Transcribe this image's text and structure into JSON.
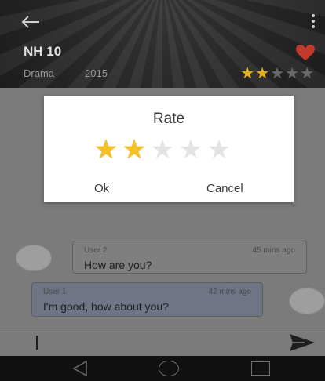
{
  "header": {
    "title": "NH 10",
    "genre": "Drama",
    "year": "2015",
    "rating_filled": 2,
    "rating_total": 5
  },
  "chat": {
    "messages": [
      {
        "user": "User 2",
        "time": "45 mins ago",
        "text": "How are you?"
      },
      {
        "user": "User 1",
        "time": "42 mins ago",
        "text": "I'm good, how about you?"
      }
    ]
  },
  "input": {
    "value": ""
  },
  "dialog": {
    "title": "Rate",
    "rating_selected": 2,
    "rating_total": 5,
    "ok_label": "Ok",
    "cancel_label": "Cancel"
  },
  "colors": {
    "star_on": "#f5c023",
    "star_off": "#e3e3e3",
    "heart": "#c0392b",
    "dialog_bg": "#ffffff"
  },
  "icons": [
    "back-arrow-icon",
    "kebab-menu-icon",
    "heart-icon",
    "star-icon",
    "send-icon",
    "nav-back-icon",
    "nav-home-icon",
    "nav-recents-icon"
  ]
}
